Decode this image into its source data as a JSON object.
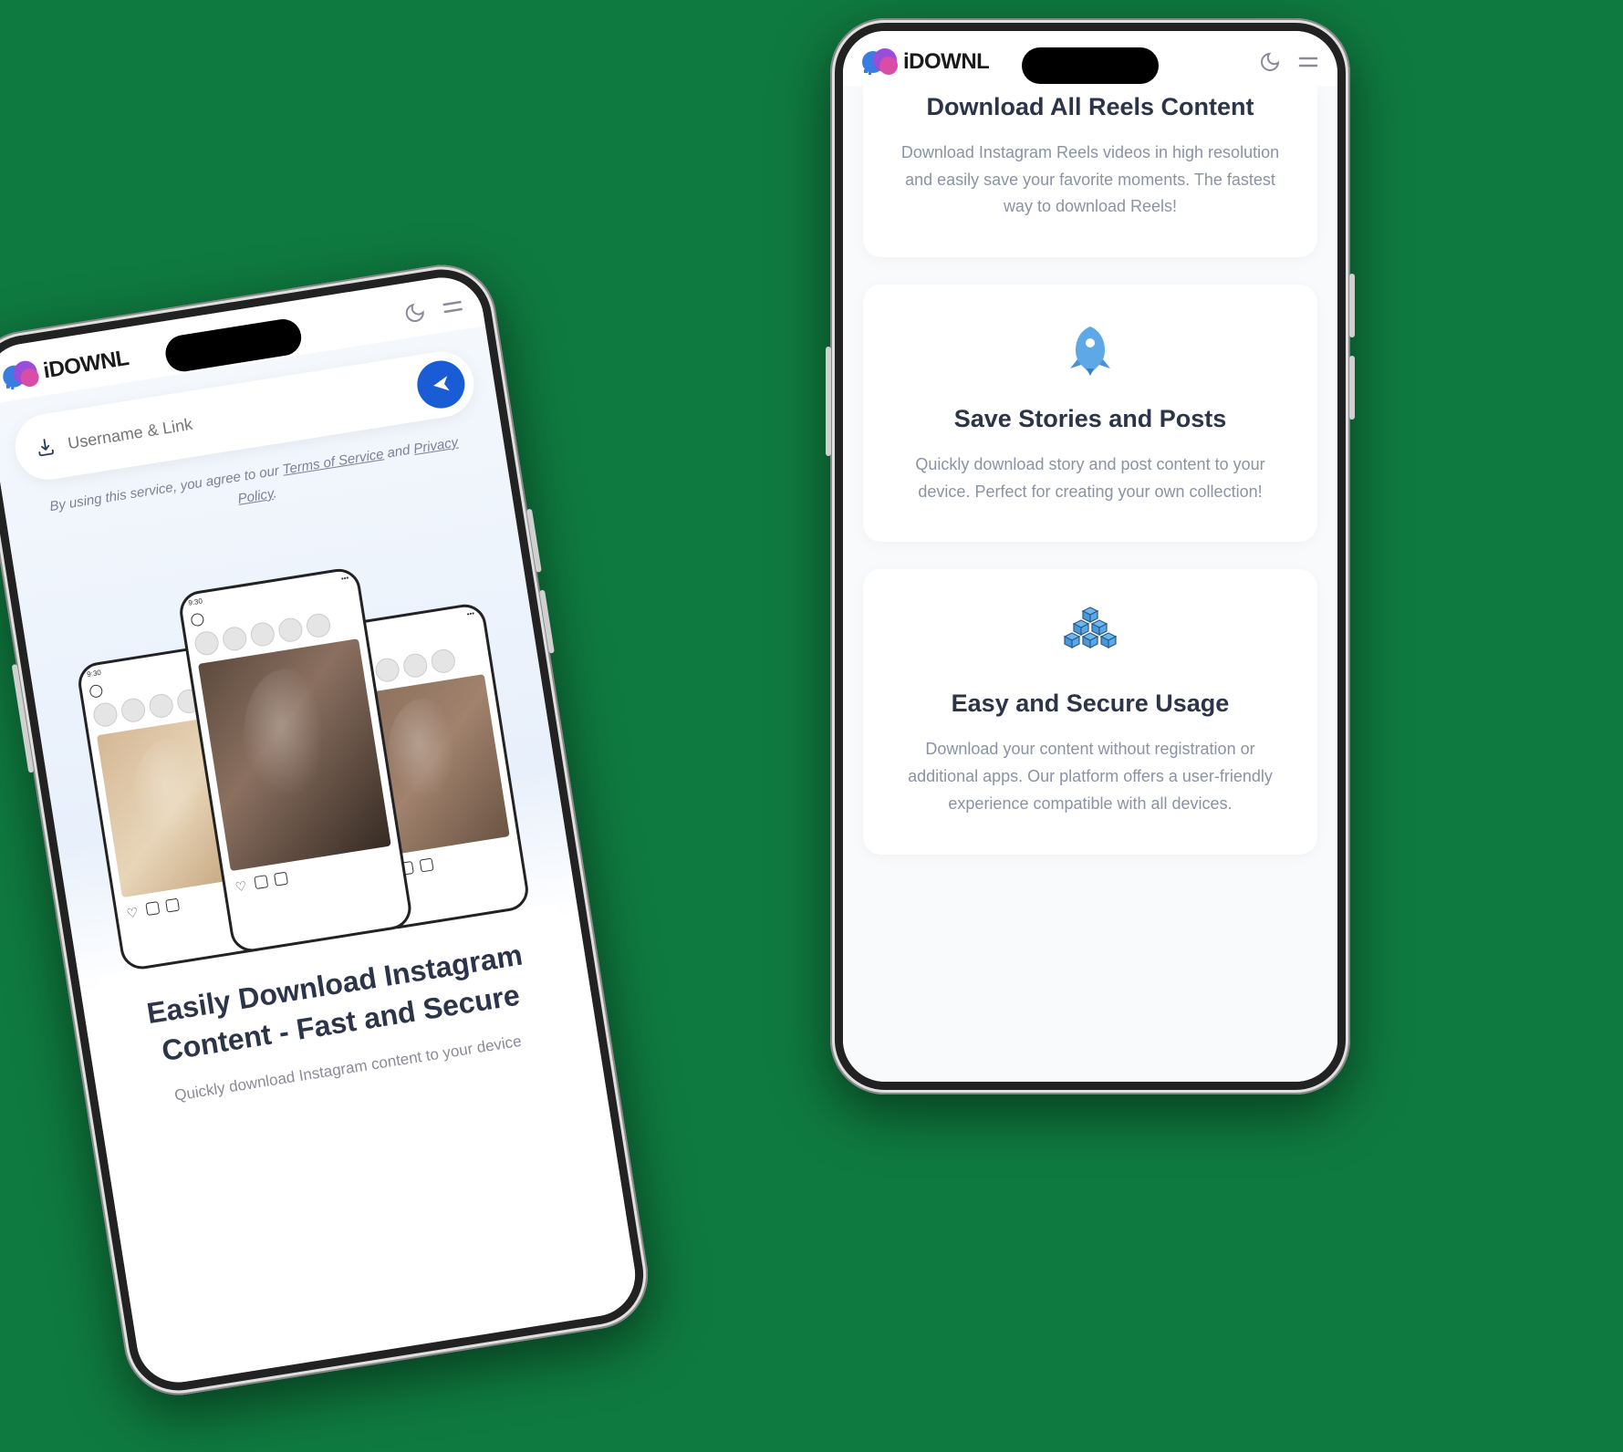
{
  "logo": {
    "text_i": "i",
    "text_rest": "DOWNL"
  },
  "left_phone": {
    "search": {
      "placeholder": "Username & Link"
    },
    "disclaimer": {
      "prefix": "By using this service, you agree to our ",
      "tos": "Terms of Service",
      "middle": " and ",
      "privacy": "Privacy Policy",
      "suffix": "."
    },
    "mini_time": "9:30",
    "hero": {
      "title": "Easily Download Instagram Content - Fast and Secure",
      "sub": "Quickly download Instagram content to your device"
    }
  },
  "right_phone": {
    "features": [
      {
        "title": "Download All Reels Content",
        "desc": "Download Instagram Reels videos in high resolution and easily save your favorite moments. The fastest way to download Reels!"
      },
      {
        "title": "Save Stories and Posts",
        "desc": "Quickly download story and post content to your device. Perfect for creating your own collection!"
      },
      {
        "title": "Easy and Secure Usage",
        "desc": "Download your content without registration or additional apps. Our platform offers a user-friendly experience compatible with all devices."
      }
    ]
  }
}
